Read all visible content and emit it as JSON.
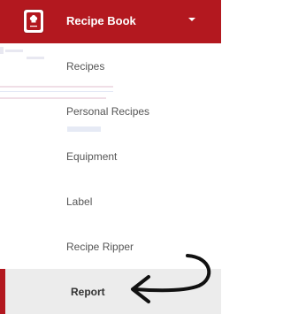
{
  "app": {
    "title": "Recipe Book",
    "brand_color": "#b3181f"
  },
  "header": {
    "logo_icon": "chef-hat-book-icon",
    "dropdown_icon": "caret-down-icon"
  },
  "menu": {
    "items": [
      {
        "label": "Recipes"
      },
      {
        "label": "Personal Recipes"
      },
      {
        "label": "Equipment"
      },
      {
        "label": "Label"
      },
      {
        "label": "Recipe Ripper"
      }
    ],
    "active_item": {
      "label": "Report"
    }
  },
  "annotation": {
    "arrow_icon": "hand-drawn-arrow-icon"
  }
}
